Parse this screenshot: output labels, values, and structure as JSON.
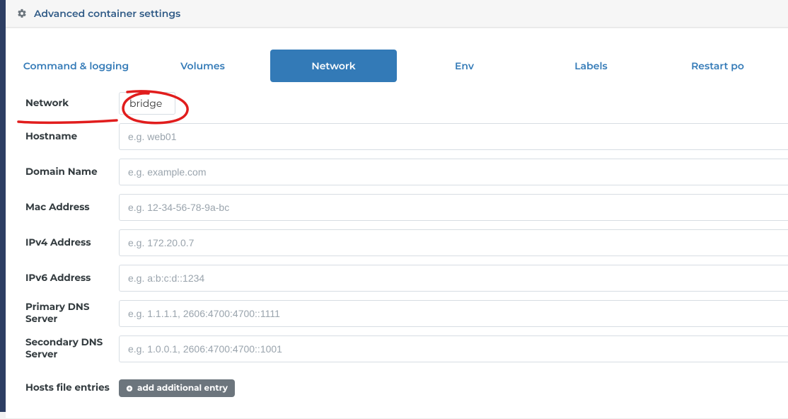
{
  "header": {
    "title": "Advanced container settings"
  },
  "tabs": [
    {
      "id": "command-logging",
      "label": "Command & logging",
      "active": false
    },
    {
      "id": "volumes",
      "label": "Volumes",
      "active": false
    },
    {
      "id": "network",
      "label": "Network",
      "active": true
    },
    {
      "id": "env",
      "label": "Env",
      "active": false
    },
    {
      "id": "labels",
      "label": "Labels",
      "active": false
    },
    {
      "id": "restart-policy",
      "label": "Restart policy",
      "active": false
    }
  ],
  "network": {
    "label": "Network",
    "selected": "bridge"
  },
  "fields": {
    "hostname": {
      "label": "Hostname",
      "placeholder": "e.g. web01",
      "value": ""
    },
    "domain": {
      "label": "Domain Name",
      "placeholder": "e.g. example.com",
      "value": ""
    },
    "mac": {
      "label": "Mac Address",
      "placeholder": "e.g. 12-34-56-78-9a-bc",
      "value": ""
    },
    "ipv4": {
      "label": "IPv4 Address",
      "placeholder": "e.g. 172.20.0.7",
      "value": ""
    },
    "ipv6": {
      "label": "IPv6 Address",
      "placeholder": "e.g. a:b:c:d::1234",
      "value": ""
    },
    "dns1": {
      "label": "Primary DNS Server",
      "placeholder": "e.g. 1.1.1.1, 2606:4700:4700::1111",
      "value": ""
    },
    "dns2": {
      "label": "Secondary DNS Server",
      "placeholder": "e.g. 1.0.0.1, 2606:4700:4700::1001",
      "value": ""
    }
  },
  "hosts": {
    "label": "Hosts file entries",
    "button": "add additional entry"
  },
  "colors": {
    "accent": "#337ab7",
    "sidebar": "#2d3e63",
    "annotation": "#e11d1d"
  }
}
